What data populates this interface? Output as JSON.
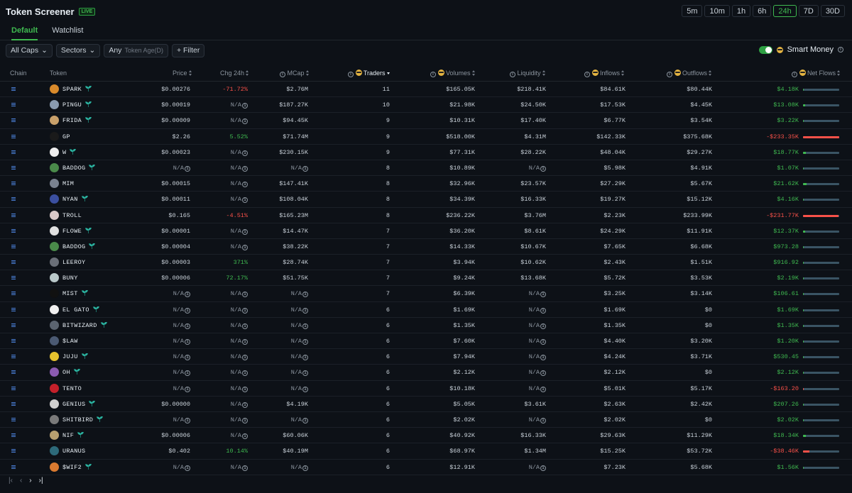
{
  "header": {
    "title": "Token Screener",
    "live_badge": "LIVE",
    "timeframes": [
      "5m",
      "10m",
      "1h",
      "6h",
      "24h",
      "7D",
      "30D"
    ],
    "active_timeframe": "24h"
  },
  "tabs": [
    "Default",
    "Watchlist"
  ],
  "active_tab": "Default",
  "filters": {
    "caps": "All Caps",
    "sectors": "Sectors",
    "age_value": "Any",
    "age_label": "Token Age(D)",
    "filter": "+ Filter"
  },
  "smart_money": {
    "label": "Smart Money",
    "enabled": true
  },
  "columns": {
    "chain": "Chain",
    "token": "Token",
    "price": "Price",
    "chg": "Chg 24h",
    "mcap": "MCap",
    "traders": "Traders",
    "volumes": "Volumes",
    "liquidity": "Liquidity",
    "inflows": "Inflows",
    "outflows": "Outflows",
    "netflows": "Net Flows"
  },
  "colors": {
    "positive": "#3fb950",
    "negative": "#f85149",
    "accent": "#3fb950",
    "bar_track": "#3a5464"
  },
  "rows": [
    {
      "token": "SPARK",
      "avatar": "#d98a2b",
      "sprout": true,
      "price": "$0.00276",
      "chg": "-71.72%",
      "chg_dir": "neg",
      "mcap": "$2.76M",
      "traders": "11",
      "volumes": "$165.05K",
      "liquidity": "$218.41K",
      "inflows": "$84.61K",
      "outflows": "$80.44K",
      "netflows": "$4.18K",
      "net_dir": "pos",
      "net_fill": 0.02
    },
    {
      "token": "PINGU",
      "avatar": "#8a9bb0",
      "sprout": true,
      "price": "$0.00019",
      "chg": "N/A",
      "chg_dir": "na",
      "mcap": "$187.27K",
      "traders": "10",
      "volumes": "$21.98K",
      "liquidity": "$24.50K",
      "inflows": "$17.53K",
      "outflows": "$4.45K",
      "netflows": "$13.08K",
      "net_dir": "pos",
      "net_fill": 0.06
    },
    {
      "token": "FRIDA",
      "avatar": "#c9a06a",
      "sprout": true,
      "price": "$0.00009",
      "chg": "N/A",
      "chg_dir": "na",
      "mcap": "$94.45K",
      "traders": "9",
      "volumes": "$10.31K",
      "liquidity": "$17.40K",
      "inflows": "$6.77K",
      "outflows": "$3.54K",
      "netflows": "$3.22K",
      "net_dir": "pos",
      "net_fill": 0.01
    },
    {
      "token": "GP",
      "avatar": "#1a1a1a",
      "sprout": false,
      "price": "$2.26",
      "chg": "5.52%",
      "chg_dir": "pos",
      "mcap": "$71.74M",
      "traders": "9",
      "volumes": "$518.00K",
      "liquidity": "$4.31M",
      "inflows": "$142.33K",
      "outflows": "$375.68K",
      "netflows": "-$233.35K",
      "net_dir": "neg",
      "net_fill": 1.0
    },
    {
      "token": "W",
      "avatar": "#eeeeee",
      "sprout": true,
      "price": "$0.00023",
      "chg": "N/A",
      "chg_dir": "na",
      "mcap": "$230.15K",
      "traders": "9",
      "volumes": "$77.31K",
      "liquidity": "$28.22K",
      "inflows": "$48.04K",
      "outflows": "$29.27K",
      "netflows": "$18.77K",
      "net_dir": "pos",
      "net_fill": 0.08
    },
    {
      "token": "BADDOG",
      "avatar": "#4a8a4a",
      "sprout": true,
      "price": "N/A",
      "chg": "N/A",
      "chg_dir": "na",
      "mcap": "N/A",
      "traders": "8",
      "volumes": "$10.89K",
      "liquidity": "N/A",
      "inflows": "$5.98K",
      "outflows": "$4.91K",
      "netflows": "$1.07K",
      "net_dir": "pos",
      "net_fill": 0.005
    },
    {
      "token": "MIM",
      "avatar": "#7a8290",
      "sprout": false,
      "price": "$0.00015",
      "chg": "N/A",
      "chg_dir": "na",
      "mcap": "$147.41K",
      "traders": "8",
      "volumes": "$32.96K",
      "liquidity": "$23.57K",
      "inflows": "$27.29K",
      "outflows": "$5.67K",
      "netflows": "$21.62K",
      "net_dir": "pos",
      "net_fill": 0.09
    },
    {
      "token": "NYAN",
      "avatar": "#3b4fa0",
      "sprout": true,
      "price": "$0.00011",
      "chg": "N/A",
      "chg_dir": "na",
      "mcap": "$108.04K",
      "traders": "8",
      "volumes": "$34.39K",
      "liquidity": "$16.33K",
      "inflows": "$19.27K",
      "outflows": "$15.12K",
      "netflows": "$4.16K",
      "net_dir": "pos",
      "net_fill": 0.02
    },
    {
      "token": "TROLL",
      "avatar": "#d8c8c8",
      "sprout": false,
      "price": "$0.165",
      "chg": "-4.51%",
      "chg_dir": "neg",
      "mcap": "$165.23M",
      "traders": "8",
      "volumes": "$236.22K",
      "liquidity": "$3.76M",
      "inflows": "$2.23K",
      "outflows": "$233.99K",
      "netflows": "-$231.77K",
      "net_dir": "neg",
      "net_fill": 0.99
    },
    {
      "token": "FLOWE",
      "avatar": "#e0e0e0",
      "sprout": true,
      "price": "$0.00001",
      "chg": "N/A",
      "chg_dir": "na",
      "mcap": "$14.47K",
      "traders": "7",
      "volumes": "$36.20K",
      "liquidity": "$8.61K",
      "inflows": "$24.29K",
      "outflows": "$11.91K",
      "netflows": "$12.37K",
      "net_dir": "pos",
      "net_fill": 0.05
    },
    {
      "token": "BADDOG",
      "avatar": "#4a8a4a",
      "sprout": true,
      "price": "$0.00004",
      "chg": "N/A",
      "chg_dir": "na",
      "mcap": "$38.22K",
      "traders": "7",
      "volumes": "$14.33K",
      "liquidity": "$10.67K",
      "inflows": "$7.65K",
      "outflows": "$6.68K",
      "netflows": "$973.28",
      "net_dir": "pos",
      "net_fill": 0.004
    },
    {
      "token": "LEEROY",
      "avatar": "#6a6f78",
      "sprout": false,
      "price": "$0.00003",
      "chg": "371%",
      "chg_dir": "pos",
      "mcap": "$28.74K",
      "traders": "7",
      "volumes": "$3.94K",
      "liquidity": "$10.62K",
      "inflows": "$2.43K",
      "outflows": "$1.51K",
      "netflows": "$916.92",
      "net_dir": "pos",
      "net_fill": 0.004
    },
    {
      "token": "BUNY",
      "avatar": "#b9c8c9",
      "sprout": false,
      "price": "$0.00006",
      "chg": "72.17%",
      "chg_dir": "pos",
      "mcap": "$51.75K",
      "traders": "7",
      "volumes": "$9.24K",
      "liquidity": "$13.68K",
      "inflows": "$5.72K",
      "outflows": "$3.53K",
      "netflows": "$2.19K",
      "net_dir": "pos",
      "net_fill": 0.01
    },
    {
      "token": "MIST",
      "avatar": "#111111",
      "sprout": true,
      "price": "N/A",
      "chg": "N/A",
      "chg_dir": "na",
      "mcap": "N/A",
      "traders": "7",
      "volumes": "$6.39K",
      "liquidity": "N/A",
      "inflows": "$3.25K",
      "outflows": "$3.14K",
      "netflows": "$106.61",
      "net_dir": "pos",
      "net_fill": 0.001
    },
    {
      "token": "EL GATO",
      "avatar": "#f0f0f0",
      "sprout": true,
      "price": "N/A",
      "chg": "N/A",
      "chg_dir": "na",
      "mcap": "N/A",
      "traders": "6",
      "volumes": "$1.69K",
      "liquidity": "N/A",
      "inflows": "$1.69K",
      "outflows": "$0",
      "netflows": "$1.69K",
      "net_dir": "pos",
      "net_fill": 0.007
    },
    {
      "token": "BITWIZARD",
      "avatar": "#5b6470",
      "sprout": true,
      "price": "N/A",
      "chg": "N/A",
      "chg_dir": "na",
      "mcap": "N/A",
      "traders": "6",
      "volumes": "$1.35K",
      "liquidity": "N/A",
      "inflows": "$1.35K",
      "outflows": "$0",
      "netflows": "$1.35K",
      "net_dir": "pos",
      "net_fill": 0.006
    },
    {
      "token": "$LAW",
      "avatar": "#4b5a73",
      "sprout": false,
      "price": "N/A",
      "chg": "N/A",
      "chg_dir": "na",
      "mcap": "N/A",
      "traders": "6",
      "volumes": "$7.60K",
      "liquidity": "N/A",
      "inflows": "$4.40K",
      "outflows": "$3.20K",
      "netflows": "$1.20K",
      "net_dir": "pos",
      "net_fill": 0.005
    },
    {
      "token": "JUJU",
      "avatar": "#e6c22e",
      "sprout": true,
      "price": "N/A",
      "chg": "N/A",
      "chg_dir": "na",
      "mcap": "N/A",
      "traders": "6",
      "volumes": "$7.94K",
      "liquidity": "N/A",
      "inflows": "$4.24K",
      "outflows": "$3.71K",
      "netflows": "$530.45",
      "net_dir": "pos",
      "net_fill": 0.002
    },
    {
      "token": "OH",
      "avatar": "#8a5ab0",
      "sprout": true,
      "price": "N/A",
      "chg": "N/A",
      "chg_dir": "na",
      "mcap": "N/A",
      "traders": "6",
      "volumes": "$2.12K",
      "liquidity": "N/A",
      "inflows": "$2.12K",
      "outflows": "$0",
      "netflows": "$2.12K",
      "net_dir": "pos",
      "net_fill": 0.009
    },
    {
      "token": "TENTO",
      "avatar": "#c4202a",
      "sprout": false,
      "price": "N/A",
      "chg": "N/A",
      "chg_dir": "na",
      "mcap": "N/A",
      "traders": "6",
      "volumes": "$10.18K",
      "liquidity": "N/A",
      "inflows": "$5.01K",
      "outflows": "$5.17K",
      "netflows": "-$163.20",
      "net_dir": "neg",
      "net_fill": 0.001
    },
    {
      "token": "GENIUS",
      "avatar": "#d0d0d0",
      "sprout": true,
      "price": "$0.00000",
      "chg": "N/A",
      "chg_dir": "na",
      "mcap": "$4.19K",
      "traders": "6",
      "volumes": "$5.05K",
      "liquidity": "$3.61K",
      "inflows": "$2.63K",
      "outflows": "$2.42K",
      "netflows": "$207.26",
      "net_dir": "pos",
      "net_fill": 0.001
    },
    {
      "token": "SHITBIRD",
      "avatar": "#7a7a7a",
      "sprout": true,
      "price": "N/A",
      "chg": "N/A",
      "chg_dir": "na",
      "mcap": "N/A",
      "traders": "6",
      "volumes": "$2.02K",
      "liquidity": "N/A",
      "inflows": "$2.02K",
      "outflows": "$0",
      "netflows": "$2.02K",
      "net_dir": "pos",
      "net_fill": 0.009
    },
    {
      "token": "NIF",
      "avatar": "#b8a070",
      "sprout": true,
      "price": "$0.00006",
      "chg": "N/A",
      "chg_dir": "na",
      "mcap": "$60.06K",
      "traders": "6",
      "volumes": "$40.92K",
      "liquidity": "$16.33K",
      "inflows": "$29.63K",
      "outflows": "$11.29K",
      "netflows": "$18.34K",
      "net_dir": "pos",
      "net_fill": 0.08
    },
    {
      "token": "URANUS",
      "avatar": "#2d6a7a",
      "sprout": false,
      "price": "$0.402",
      "chg": "10.14%",
      "chg_dir": "pos",
      "mcap": "$40.19M",
      "traders": "6",
      "volumes": "$68.97K",
      "liquidity": "$1.34M",
      "inflows": "$15.25K",
      "outflows": "$53.72K",
      "netflows": "-$38.46K",
      "net_dir": "neg",
      "net_fill": 0.17
    },
    {
      "token": "$WIF2",
      "avatar": "#d97a30",
      "sprout": true,
      "price": "N/A",
      "chg": "N/A",
      "chg_dir": "na",
      "mcap": "N/A",
      "traders": "6",
      "volumes": "$12.91K",
      "liquidity": "N/A",
      "inflows": "$7.23K",
      "outflows": "$5.68K",
      "netflows": "$1.56K",
      "net_dir": "pos",
      "net_fill": 0.007
    }
  ],
  "pager": {
    "first": "|‹",
    "prev": "‹",
    "next": "›",
    "last": "›|"
  }
}
